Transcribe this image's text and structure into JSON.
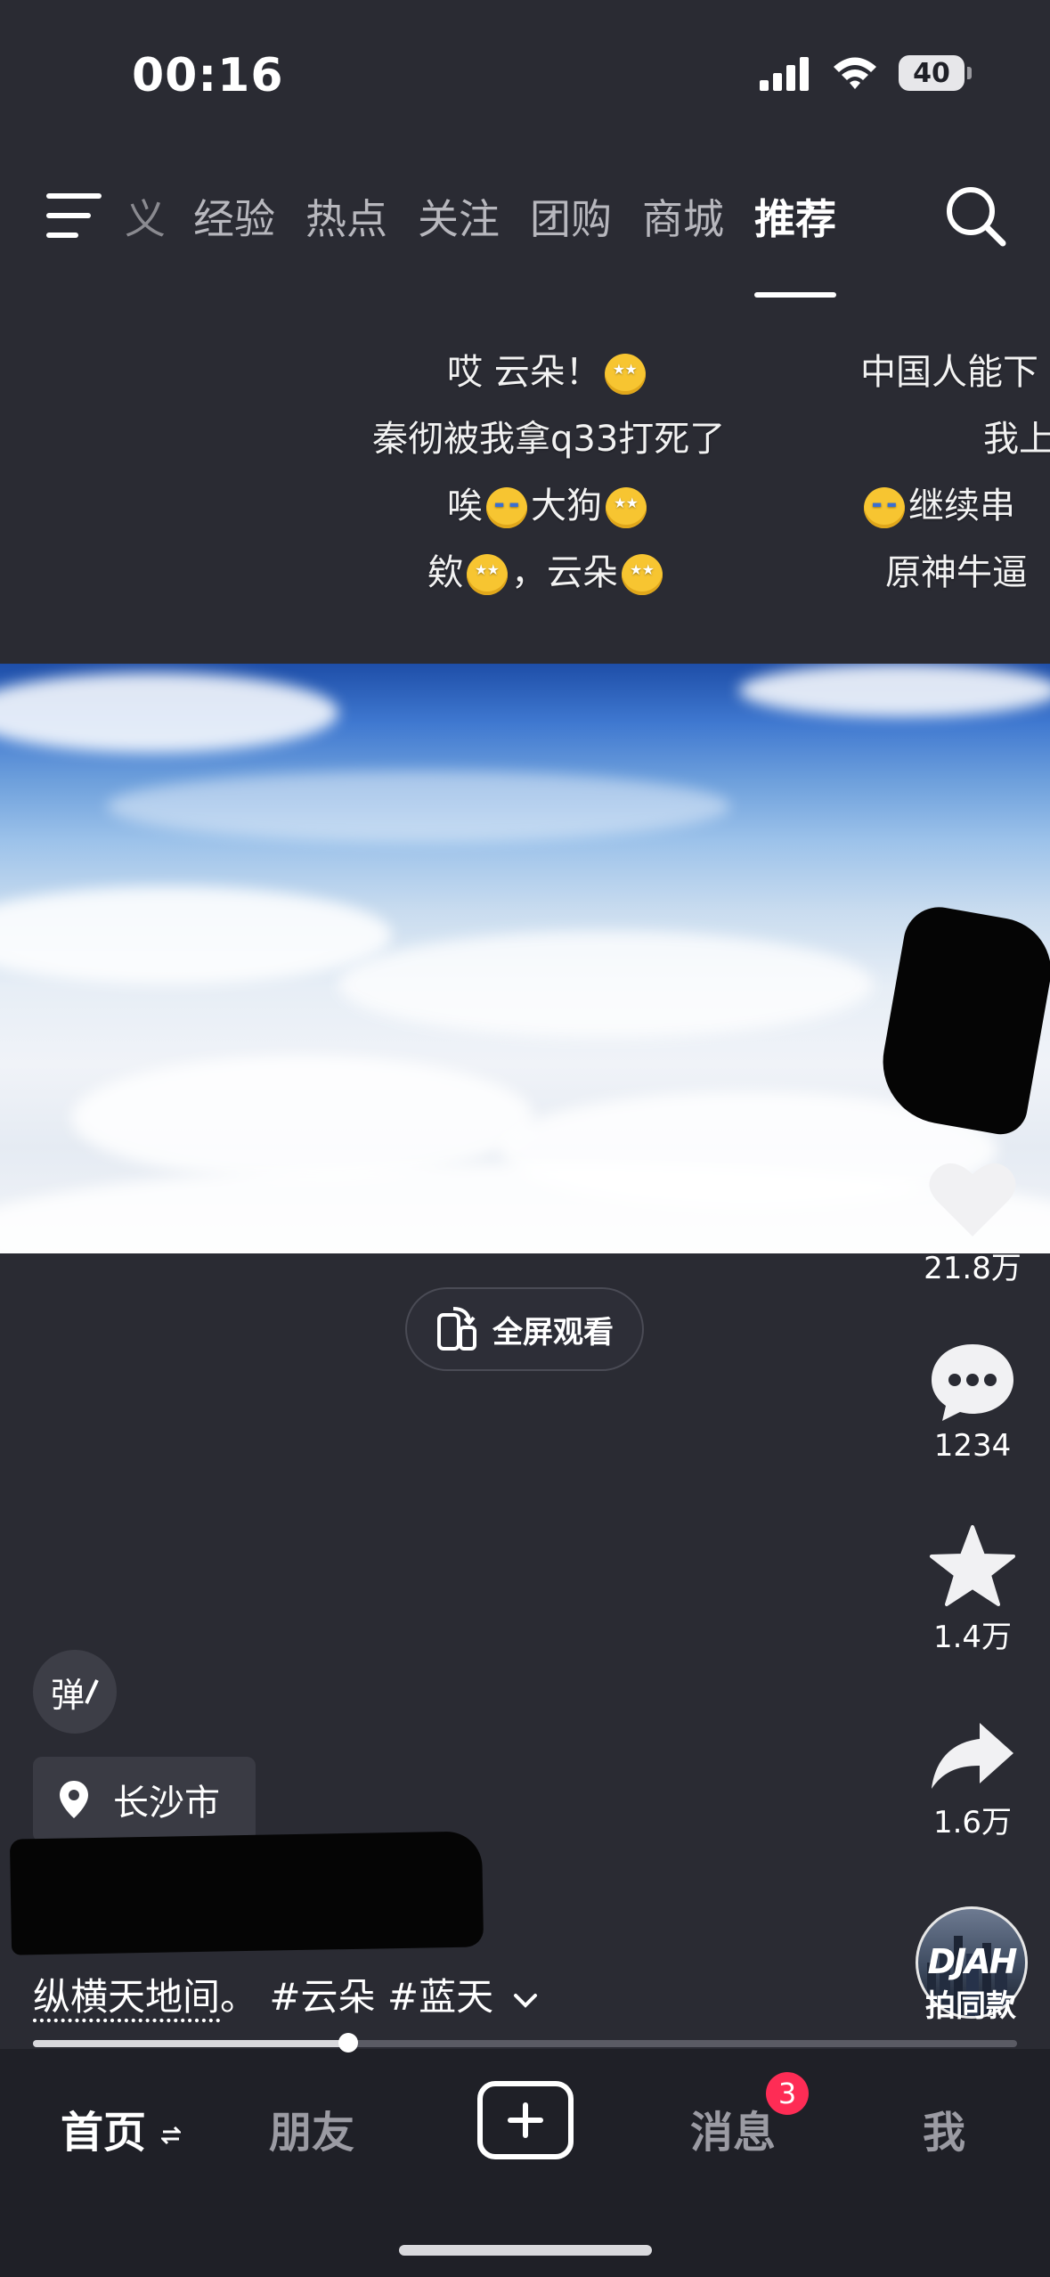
{
  "status_bar": {
    "time": "00:16",
    "battery": "40"
  },
  "top_nav": {
    "partial_tab": "义",
    "tabs": [
      "经验",
      "热点",
      "关注",
      "团购",
      "商城",
      "推荐"
    ],
    "active_tab": "推荐"
  },
  "danmaku": {
    "col1": {
      "line1": "哎 云朵！",
      "line2": "秦彻被我拿q33打死了",
      "line3_a": "唉",
      "line3_b": "大狗",
      "line4_a": "欸",
      "line4_b": "，云朵"
    },
    "col2": {
      "line1": "中国人能下",
      "line2": "我上",
      "line3": "继续串",
      "line4": "原神牛逼"
    }
  },
  "fullscreen_button": {
    "label": "全屏观看"
  },
  "actions": {
    "likes": "21.8万",
    "comments": "1234",
    "favorites": "1.4万",
    "shares": "1.6万",
    "same_style_label": "拍同款",
    "avatar_text": "DJAH"
  },
  "video_info": {
    "danmu_toggle": "弹",
    "location": "长沙市",
    "caption_first": "纵横天地间",
    "caption_rest": "。 #云朵 #蓝天",
    "progress": 0.32
  },
  "bottom_nav": {
    "home": "首页",
    "friends": "朋友",
    "messages": "消息",
    "messages_badge": "3",
    "me": "我"
  },
  "colors": {
    "badge": "#fe2c55",
    "background": "#2a2b33",
    "nav_bg": "#1f2027"
  }
}
